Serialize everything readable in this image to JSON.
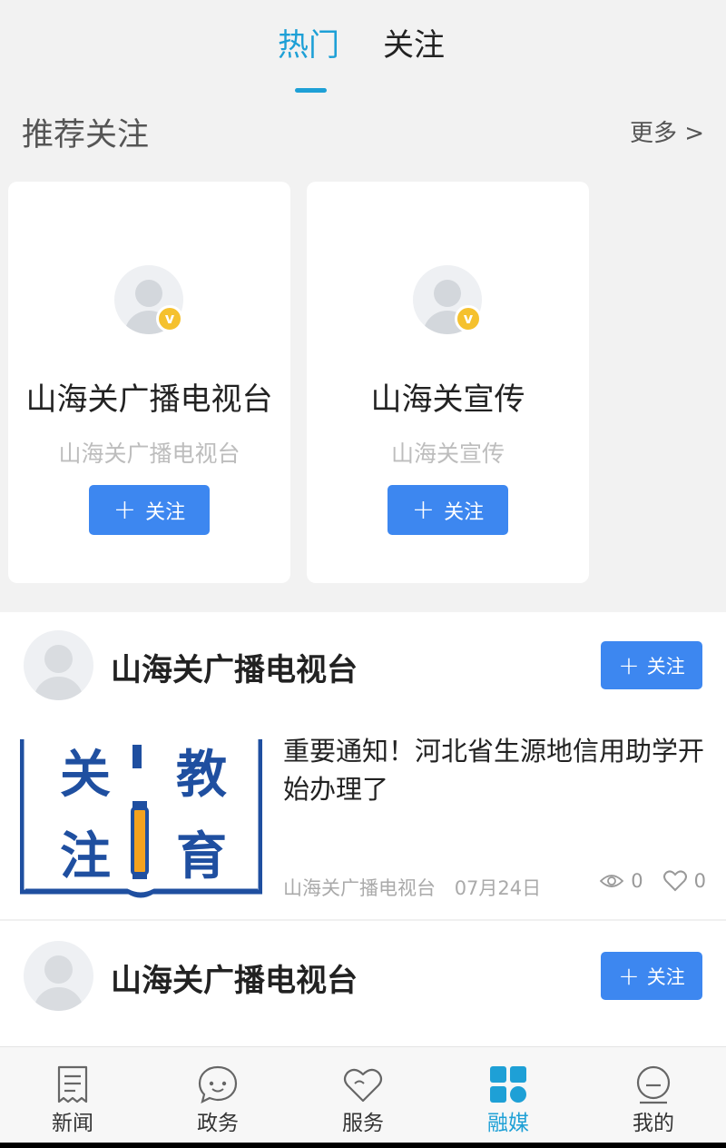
{
  "top_tabs": {
    "hot": "热门",
    "follow": "关注"
  },
  "recommend": {
    "title": "推荐关注",
    "more": "更多 >",
    "badge": "v",
    "cards": [
      {
        "name": "山海关广播电视台",
        "subtitle": "山海关广播电视台",
        "button": "关注"
      },
      {
        "name": "山海关宣传",
        "subtitle": "山海关宣传",
        "button": "关注"
      }
    ]
  },
  "feed": [
    {
      "author": "山海关广播电视台",
      "button": "关注",
      "article": {
        "title": "重要通知！河北省生源地信用助学开始办理了",
        "source": "山海关广播电视台",
        "date": "07月24日",
        "views": "0",
        "likes": "0",
        "thumbnail_text": [
          "关",
          "注",
          "教",
          "育"
        ]
      }
    },
    {
      "author": "山海关广播电视台",
      "button": "关注"
    }
  ],
  "bottom_nav": [
    {
      "label": "新闻",
      "icon": "news-icon",
      "active": false
    },
    {
      "label": "政务",
      "icon": "chat-bubble-icon",
      "active": false
    },
    {
      "label": "服务",
      "icon": "heart-icon",
      "active": false
    },
    {
      "label": "融媒",
      "icon": "grid-icon",
      "active": true
    },
    {
      "label": "我的",
      "icon": "profile-face-icon",
      "active": false
    }
  ],
  "colors": {
    "accent": "#1ea0d6",
    "button": "#3d87f0",
    "badge": "#f5c12e"
  }
}
